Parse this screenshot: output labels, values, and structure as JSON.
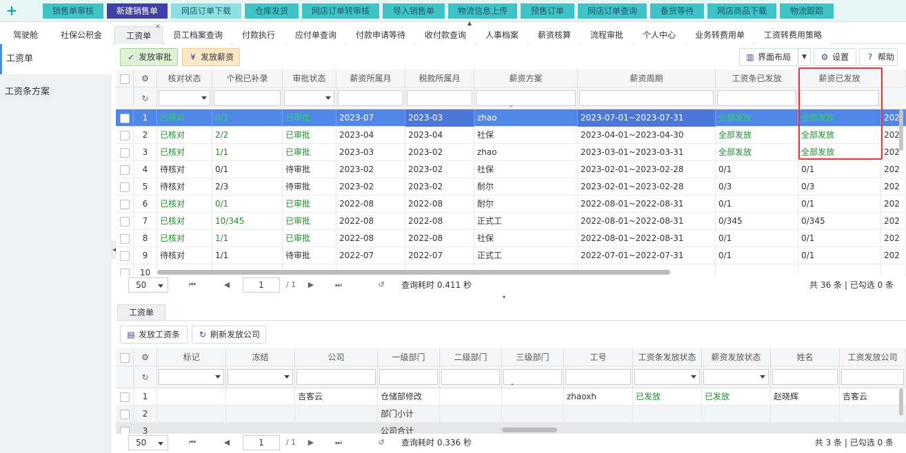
{
  "quick_buttons": [
    "销售单审核",
    "新建销售单",
    "网店订单下载",
    "仓库发货",
    "网店订单转审核",
    "导入销售单",
    "物流信息上传",
    "预售订单",
    "网店订单查询",
    "备货等待",
    "网店商品下载",
    "物流跟踪"
  ],
  "tabs": [
    "驾驶舱",
    "社保公积金",
    "工资单",
    "员工档案查询",
    "付款执行",
    "应付单查询",
    "付款申请等待",
    "收付款查询",
    "人事档案",
    "薪资核算",
    "流程审批",
    "个人中心",
    "业务转费用单",
    "工资转费用策略"
  ],
  "active_tab_close": "×",
  "sidebar": [
    "工资单",
    "工资条方案"
  ],
  "toolbar": {
    "approve": "发放审批",
    "pay": "发放薪资",
    "layout": "界面布局",
    "settings": "设置",
    "help": "帮助"
  },
  "grid_main": {
    "headers": [
      "核对状态",
      "个税已补录",
      "审批状态",
      "薪资所属月",
      "税款所属月",
      "薪资方案",
      "薪资周期",
      "工资条已发放",
      "薪资已发放"
    ],
    "rows": [
      [
        "1",
        "已核对",
        "0/1",
        "已审批",
        "2023-07",
        "2023-03",
        "zhao",
        "2023-07-01~2023-07-31",
        "全部发放",
        "全部发放",
        "202"
      ],
      [
        "2",
        "已核对",
        "2/2",
        "已审批",
        "2023-04",
        "2023-04",
        "社保",
        "2023-04-01~2023-04-30",
        "全部发放",
        "全部发放",
        "202"
      ],
      [
        "3",
        "已核对",
        "1/1",
        "已审批",
        "2023-03",
        "2023-02",
        "zhao",
        "2023-03-01~2023-03-31",
        "全部发放",
        "全部发放",
        "202"
      ],
      [
        "4",
        "待核对",
        "0/1",
        "待审批",
        "2023-02",
        "2023-02",
        "社保",
        "2023-02-01~2023-02-28",
        "0/1",
        "0/1",
        "202"
      ],
      [
        "5",
        "待核对",
        "2/3",
        "待审批",
        "2023-02",
        "2023-02",
        "耐尔",
        "2023-02-01~2023-02-28",
        "0/3",
        "0/3",
        "202"
      ],
      [
        "6",
        "已核对",
        "0/1",
        "已审批",
        "2022-08",
        "2022-08",
        "耐尔",
        "2022-08-01~2022-08-31",
        "0/1",
        "0/1",
        "202"
      ],
      [
        "7",
        "已核对",
        "10/345",
        "已审批",
        "2022-08",
        "2022-08",
        "正式工",
        "2022-08-01~2022-08-31",
        "0/345",
        "0/345",
        "202"
      ],
      [
        "8",
        "已核对",
        "1/1",
        "已审批",
        "2022-08",
        "2022-08",
        "社保",
        "2022-08-01~2022-08-31",
        "0/1",
        "0/1",
        "202"
      ],
      [
        "9",
        "待核对",
        "1/1",
        "待审批",
        "2022-07",
        "2022-07",
        "正式工",
        "2022-07-01~2022-07-31",
        "0/1",
        "0/1",
        "202"
      ],
      [
        "10",
        "",
        "",
        "",
        "",
        "",
        "",
        "",
        "",
        "",
        ""
      ]
    ]
  },
  "pager_main": {
    "size": "50",
    "page": "1",
    "total_pages": "/ 1",
    "time": "查询耗时 0.411 秒",
    "summary": "共 36 条 | 已勾选 0 条"
  },
  "sub_tab": "工资单",
  "sub_toolbar": {
    "send": "发放工资条",
    "refresh": "刷新发放公司"
  },
  "grid_sub": {
    "headers": [
      "标记",
      "冻结",
      "公司",
      "一级部门",
      "二级部门",
      "三级部门",
      "工号",
      "工资条发放状态",
      "薪资发放状态",
      "姓名",
      "工资发放公司"
    ],
    "rows": [
      [
        "1",
        "",
        "",
        "吉客云",
        "仓储部修改",
        "",
        "",
        "zhaoxh",
        "已发放",
        "已发放",
        "赵晓辉",
        "吉客云"
      ],
      [
        "2",
        "",
        "",
        "",
        "部门小计",
        "",
        "",
        "",
        "",
        "",
        "",
        ""
      ],
      [
        "3",
        "",
        "",
        "",
        "公司合计",
        "",
        "",
        "",
        "",
        "",
        "",
        ""
      ]
    ]
  },
  "pager_sub": {
    "size": "50",
    "page": "1",
    "total_pages": "/ 1",
    "time": "查询耗时 0.336 秒",
    "summary": "共 3 条 | 已勾选 0 条"
  },
  "colors": {
    "accent": "#4f86e8",
    "quick_button": "#3fc3c9",
    "highlight_border": "#e8333a",
    "status_green": "#1f8a2d"
  }
}
